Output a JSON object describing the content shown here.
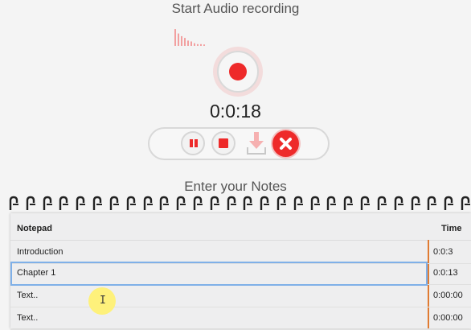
{
  "recording": {
    "title": "Start Audio recording",
    "timer": "0:0:18",
    "audio_level": [
      0.95,
      0.7,
      0.55,
      0.45,
      0.3,
      0.25,
      0.15,
      0.1,
      0.1,
      0.08
    ]
  },
  "controls": {
    "record_icon": "record-icon",
    "pause_icon": "pause-icon",
    "stop_icon": "stop-icon",
    "download_icon": "download-icon",
    "cancel_icon": "close-icon"
  },
  "notes": {
    "title": "Enter your Notes",
    "header": {
      "notepad": "Notepad",
      "time": "Time"
    },
    "rows": [
      {
        "note": "Introduction",
        "time": "0:0:3"
      },
      {
        "note": "Chapter 1",
        "time": "0:0:13"
      },
      {
        "note": "Text..",
        "time": "0:00:00"
      },
      {
        "note": "Text..",
        "time": "0:00:00"
      }
    ]
  },
  "colors": {
    "accent": "#ee2a2a",
    "time_divider": "#e07b32",
    "focus": "#7fb0e8"
  }
}
